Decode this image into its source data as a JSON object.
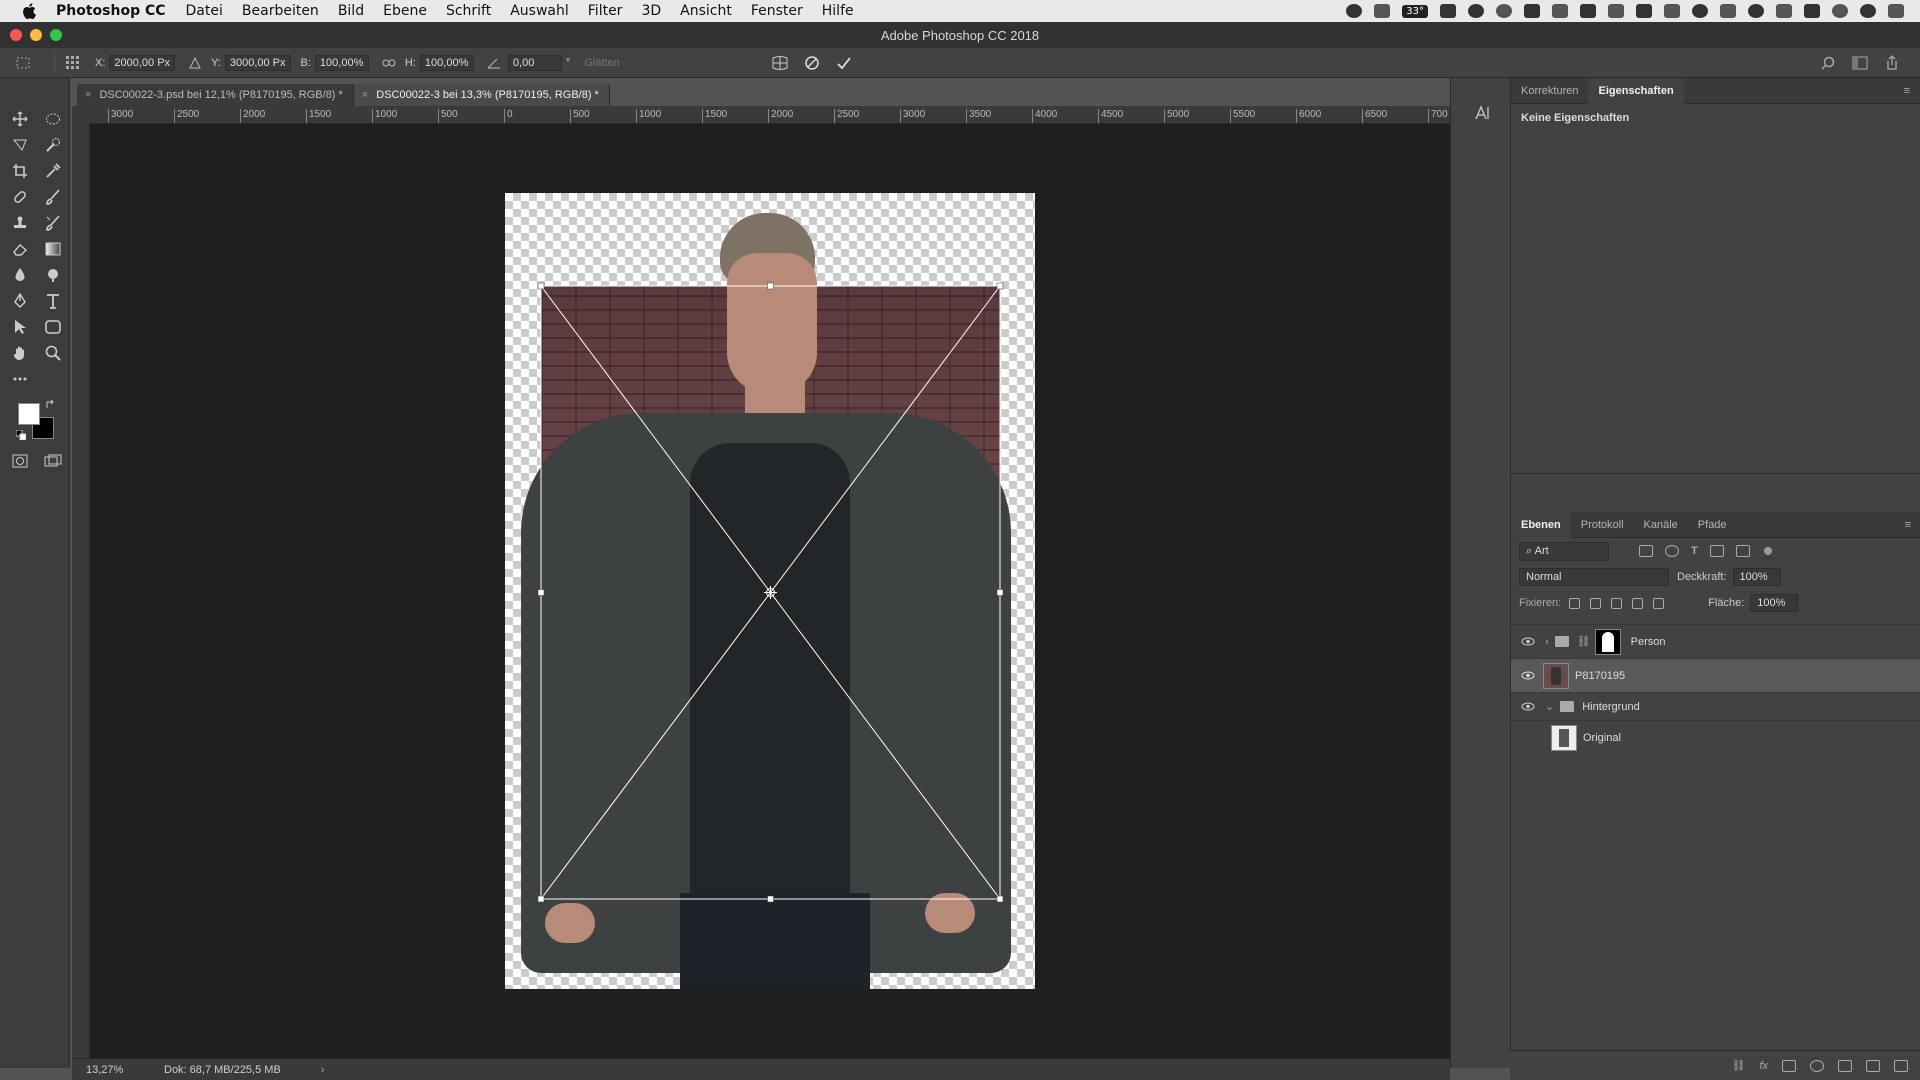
{
  "menubar": {
    "app_name": "Photoshop CC",
    "items": [
      "Datei",
      "Bearbeiten",
      "Bild",
      "Ebene",
      "Schrift",
      "Auswahl",
      "Filter",
      "3D",
      "Ansicht",
      "Fenster",
      "Hilfe"
    ],
    "temperature": "33°"
  },
  "window": {
    "title": "Adobe Photoshop CC 2018"
  },
  "options": {
    "x_label": "X:",
    "x_value": "2000,00 Px",
    "y_label": "Y:",
    "y_value": "3000,00 Px",
    "w_label": "B:",
    "w_value": "100,00%",
    "h_label": "H:",
    "h_value": "100,00%",
    "angle_value": "0,00",
    "angle_unit": "°",
    "smooth_label": "Glätten"
  },
  "tabs": [
    {
      "label": "DSC00022-3.psd bei 12,1% (P8170195, RGB/8) *",
      "active": false
    },
    {
      "label": "DSC00022-3 bei 13,3% (P8170195, RGB/8) *",
      "active": true
    }
  ],
  "ruler": {
    "top_ticks": [
      "3000",
      "2500",
      "2000",
      "1500",
      "1000",
      "500",
      "0",
      "500",
      "1000",
      "1500",
      "2000",
      "2500",
      "3000",
      "3500",
      "4000",
      "4500",
      "5000",
      "5500",
      "6000",
      "6500",
      "700"
    ]
  },
  "panels": {
    "top_tabs": [
      "Korrekturen",
      "Eigenschaften"
    ],
    "properties_text": "Keine Eigenschaften",
    "layer_tabs": [
      "Ebenen",
      "Protokoll",
      "Kanäle",
      "Pfade"
    ],
    "filter_placeholder": "Art",
    "blend_mode": "Normal",
    "opacity_label": "Deckkraft:",
    "opacity_value": "100%",
    "lock_label": "Fixieren:",
    "fill_label": "Fläche:",
    "fill_value": "100%",
    "layers": [
      {
        "name": "Person",
        "type": "group",
        "visible": true,
        "selected": false
      },
      {
        "name": "P8170195",
        "type": "layer",
        "visible": true,
        "selected": true
      },
      {
        "name": "Hintergrund",
        "type": "group",
        "visible": true,
        "selected": false
      },
      {
        "name": "Original",
        "type": "layer",
        "visible": false,
        "selected": false
      }
    ]
  },
  "status": {
    "zoom": "13,27%",
    "doc_info": "Dok: 68,7 MB/225,5 MB"
  },
  "colors": {
    "foreground": "#ffffff",
    "background": "#000000"
  }
}
